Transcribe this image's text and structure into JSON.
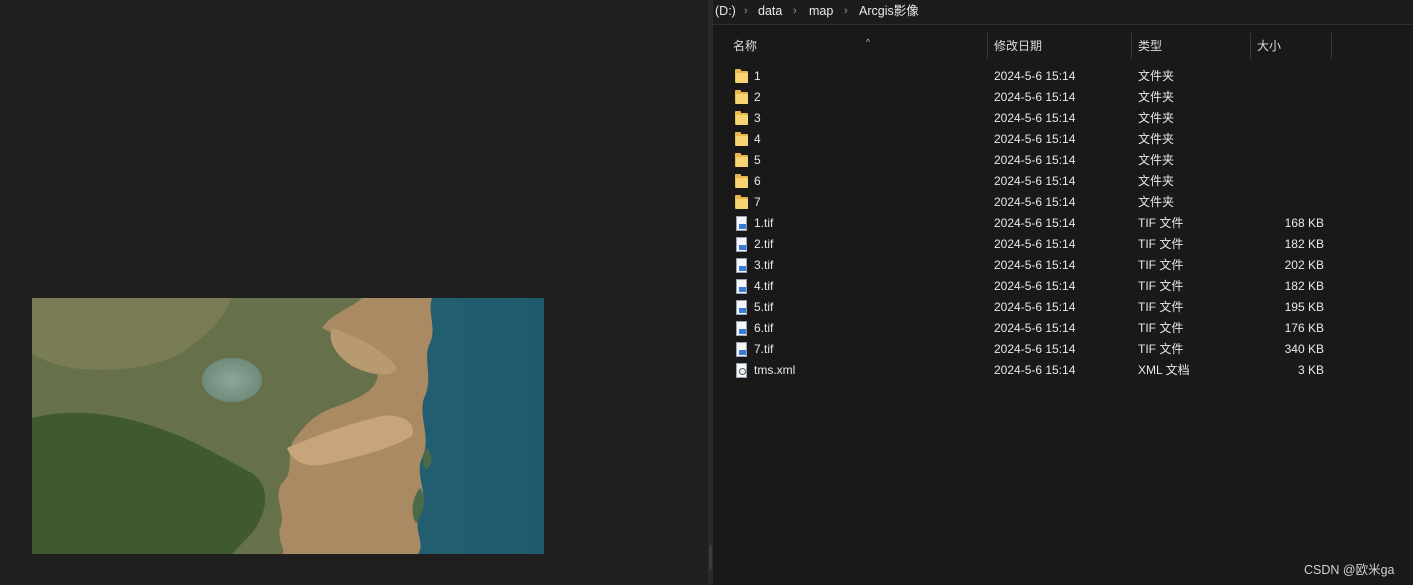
{
  "breadcrumb": {
    "drive": "(D:)",
    "items": [
      "data",
      "map",
      "Arcgis影像"
    ],
    "separator": "›"
  },
  "columns": {
    "name": "名称",
    "date": "修改日期",
    "type": "类型",
    "size": "大小",
    "sort_indicator": "^"
  },
  "files": [
    {
      "icon": "folder-icon",
      "name": "1",
      "date": "2024-5-6 15:14",
      "type": "文件夹",
      "size": ""
    },
    {
      "icon": "folder-icon",
      "name": "2",
      "date": "2024-5-6 15:14",
      "type": "文件夹",
      "size": ""
    },
    {
      "icon": "folder-icon",
      "name": "3",
      "date": "2024-5-6 15:14",
      "type": "文件夹",
      "size": ""
    },
    {
      "icon": "folder-icon",
      "name": "4",
      "date": "2024-5-6 15:14",
      "type": "文件夹",
      "size": ""
    },
    {
      "icon": "folder-icon",
      "name": "5",
      "date": "2024-5-6 15:14",
      "type": "文件夹",
      "size": ""
    },
    {
      "icon": "folder-icon",
      "name": "6",
      "date": "2024-5-6 15:14",
      "type": "文件夹",
      "size": ""
    },
    {
      "icon": "folder-icon",
      "name": "7",
      "date": "2024-5-6 15:14",
      "type": "文件夹",
      "size": ""
    },
    {
      "icon": "tif-file-icon",
      "name": "1.tif",
      "date": "2024-5-6 15:14",
      "type": "TIF 文件",
      "size": "168 KB"
    },
    {
      "icon": "tif-file-icon",
      "name": "2.tif",
      "date": "2024-5-6 15:14",
      "type": "TIF 文件",
      "size": "182 KB"
    },
    {
      "icon": "tif-file-icon",
      "name": "3.tif",
      "date": "2024-5-6 15:14",
      "type": "TIF 文件",
      "size": "202 KB"
    },
    {
      "icon": "tif-file-icon",
      "name": "4.tif",
      "date": "2024-5-6 15:14",
      "type": "TIF 文件",
      "size": "182 KB"
    },
    {
      "icon": "tif-file-icon",
      "name": "5.tif",
      "date": "2024-5-6 15:14",
      "type": "TIF 文件",
      "size": "195 KB"
    },
    {
      "icon": "tif-file-icon",
      "name": "6.tif",
      "date": "2024-5-6 15:14",
      "type": "TIF 文件",
      "size": "176 KB"
    },
    {
      "icon": "tif-file-icon",
      "name": "7.tif",
      "date": "2024-5-6 15:14",
      "type": "TIF 文件",
      "size": "340 KB"
    },
    {
      "icon": "xml-file-icon",
      "name": "tms.xml",
      "date": "2024-5-6 15:14",
      "type": "XML 文档",
      "size": "3 KB"
    }
  ],
  "watermark": "CSDN @欧米ga",
  "colors": {
    "background": "#1e1e1e",
    "explorer_background": "#191919",
    "folder": "#f9d474",
    "tif_badge": "#3a7bd5",
    "ocean": "#2f6b7a",
    "sediment": "#c9a57d",
    "land": "#5c6b3c"
  }
}
